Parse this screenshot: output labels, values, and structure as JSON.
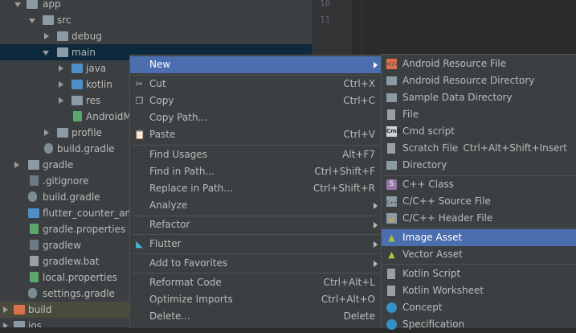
{
  "tree": {
    "items": [
      {
        "label": "app",
        "arrow": "down",
        "icon": "folder-icon"
      },
      {
        "label": "src",
        "arrow": "down",
        "icon": "folder-icon"
      },
      {
        "label": "debug",
        "arrow": "right",
        "icon": "folder-icon"
      },
      {
        "label": "main",
        "arrow": "down",
        "icon": "folder-icon"
      },
      {
        "label": "java",
        "arrow": "right",
        "icon": "folder-blue-icon"
      },
      {
        "label": "kotlin",
        "arrow": "right",
        "icon": "folder-blue-icon"
      },
      {
        "label": "res",
        "arrow": "right",
        "icon": "folder-icon"
      },
      {
        "label": "AndroidM",
        "arrow": "",
        "icon": "manifest-file-icon"
      },
      {
        "label": "profile",
        "arrow": "right",
        "icon": "folder-icon"
      },
      {
        "label": "build.gradle",
        "arrow": "",
        "icon": "gradle-elephant-icon"
      },
      {
        "label": "gradle",
        "arrow": "right",
        "icon": "folder-icon"
      },
      {
        "label": ".gitignore",
        "arrow": "",
        "icon": "gitignore-file-icon"
      },
      {
        "label": "build.gradle",
        "arrow": "",
        "icon": "gradle-elephant-icon"
      },
      {
        "label": "flutter_counter_andr",
        "arrow": "",
        "icon": "module-file-icon"
      },
      {
        "label": "gradle.properties",
        "arrow": "",
        "icon": "properties-file-icon"
      },
      {
        "label": "gradlew",
        "arrow": "",
        "icon": "script-file-icon"
      },
      {
        "label": "gradlew.bat",
        "arrow": "",
        "icon": "bat-file-icon"
      },
      {
        "label": "local.properties",
        "arrow": "",
        "icon": "properties-file-icon"
      },
      {
        "label": "settings.gradle",
        "arrow": "",
        "icon": "gradle-elephant-icon"
      },
      {
        "label": "build",
        "arrow": "right",
        "icon": "folder-orange-icon"
      },
      {
        "label": "ios",
        "arrow": "right",
        "icon": "folder-icon"
      }
    ]
  },
  "editor": {
    "lines": [
      "10",
      "11"
    ]
  },
  "context_menu": {
    "items": [
      {
        "label": "New",
        "shortcut": "",
        "submenu": true
      },
      {
        "label": "Cut",
        "shortcut": "Ctrl+X",
        "icon": "scissors-icon"
      },
      {
        "label": "Copy",
        "shortcut": "Ctrl+C",
        "icon": "copy-icon"
      },
      {
        "label": "Copy Path...",
        "shortcut": ""
      },
      {
        "label": "Paste",
        "shortcut": "Ctrl+V",
        "icon": "paste-icon"
      },
      {
        "label": "Find Usages",
        "shortcut": "Alt+F7"
      },
      {
        "label": "Find in Path...",
        "shortcut": "Ctrl+Shift+F"
      },
      {
        "label": "Replace in Path...",
        "shortcut": "Ctrl+Shift+R"
      },
      {
        "label": "Analyze",
        "shortcut": "",
        "submenu": true
      },
      {
        "label": "Refactor",
        "shortcut": "",
        "submenu": true
      },
      {
        "label": "Flutter",
        "shortcut": "",
        "submenu": true,
        "icon": "flutter-icon"
      },
      {
        "label": "Add to Favorites",
        "shortcut": "",
        "submenu": true
      },
      {
        "label": "Reformat Code",
        "shortcut": "Ctrl+Alt+L"
      },
      {
        "label": "Optimize Imports",
        "shortcut": "Ctrl+Alt+O"
      },
      {
        "label": "Delete...",
        "shortcut": "Delete"
      }
    ]
  },
  "submenu": {
    "items": [
      {
        "label": "Android Resource File",
        "shortcut": "",
        "icon": "android-resource-file-icon"
      },
      {
        "label": "Android Resource Directory",
        "shortcut": "",
        "icon": "folder-icon"
      },
      {
        "label": "Sample Data Directory",
        "shortcut": "",
        "icon": "folder-icon"
      },
      {
        "label": "File",
        "shortcut": "",
        "icon": "file-icon"
      },
      {
        "label": "Cmd script",
        "shortcut": "",
        "icon": "cmd-icon"
      },
      {
        "label": "Scratch File",
        "shortcut": "Ctrl+Alt+Shift+Insert",
        "icon": "scratch-file-icon"
      },
      {
        "label": "Directory",
        "shortcut": "",
        "icon": "folder-icon"
      },
      {
        "label": "C++ Class",
        "shortcut": "",
        "icon": "cpp-class-icon"
      },
      {
        "label": "C/C++ Source File",
        "shortcut": "",
        "icon": "cpp-source-icon"
      },
      {
        "label": "C/C++ Header File",
        "shortcut": "",
        "icon": "cpp-header-icon"
      },
      {
        "label": "Image Asset",
        "shortcut": "",
        "icon": "android-icon"
      },
      {
        "label": "Vector Asset",
        "shortcut": "",
        "icon": "android-icon"
      },
      {
        "label": "Kotlin Script",
        "shortcut": "",
        "icon": "kotlin-script-icon"
      },
      {
        "label": "Kotlin Worksheet",
        "shortcut": "",
        "icon": "kotlin-worksheet-icon"
      },
      {
        "label": "Concept",
        "shortcut": "",
        "icon": "concept-icon"
      },
      {
        "label": "Specification",
        "shortcut": "",
        "icon": "specification-icon"
      }
    ]
  },
  "colors": {
    "menu_bg": "#3c3f41",
    "selection": "#4b6eaf",
    "tree_bg": "#3c3f41",
    "editor_bg": "#2b2b2b"
  }
}
